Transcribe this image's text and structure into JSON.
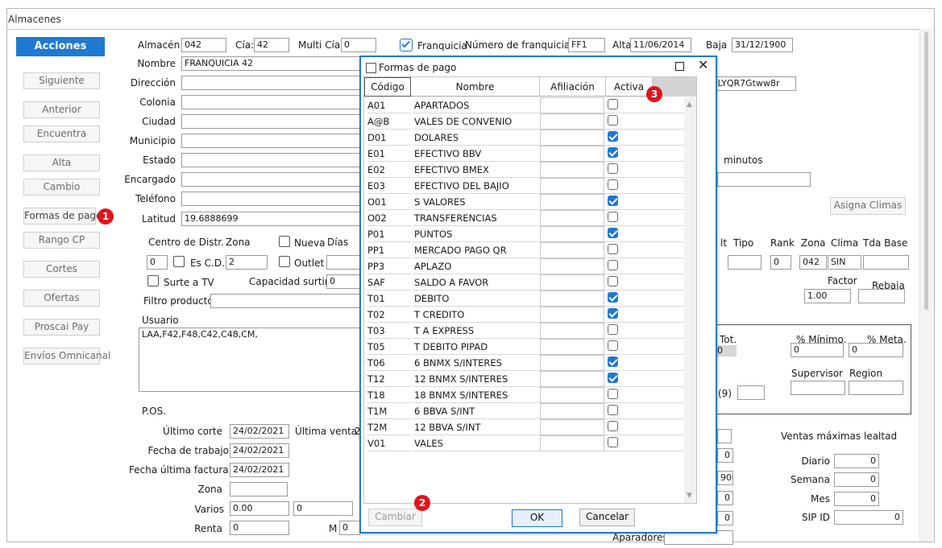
{
  "window": {
    "title": "Almacenes"
  },
  "sidebar": {
    "acciones": "Acciones",
    "buttons": [
      "Siguiente",
      "Anterior",
      "Encuentra",
      "Alta",
      "Cambio",
      "Formas de pago",
      "Rango CP",
      "Cortes",
      "Ofertas",
      "Proscai Pay",
      "Envíos Omnicanal"
    ]
  },
  "badges": {
    "b1": "1",
    "b2": "2",
    "b3": "3"
  },
  "form": {
    "almacen_label": "Almacén",
    "almacen": "042",
    "cia_label": "Cía:",
    "cia": "42",
    "multicia_label": "Multi Cía:",
    "multicia": "0",
    "franquicia_label": "Franquicia",
    "num_franquicia_label": "Número de franquicia:",
    "num_franquicia": "FF1",
    "alta_label": "Alta",
    "alta": "11/06/2014",
    "baja_label": "Baja",
    "baja": "31/12/1900",
    "nombre_label": "Nombre",
    "nombre": "FRANQUICIA 42",
    "direccion_label": "Dirección",
    "direccion_right": "MSLYQR7Gtww8r",
    "colonia_label": "Colonia",
    "ciudad_label": "Ciudad",
    "municipio_label": "Municipio",
    "estado_label": "Estado",
    "encargado_label": "Encargado",
    "telefono_label": "Teléfono",
    "latitud_label": "Latitud",
    "latitud": "19.6888699",
    "minutos_label": "minutos",
    "asigna_climas": "Asigna Climas",
    "centro_label": "Centro de Distr.",
    "zona_label": "Zona",
    "nueva_label": "Nueva",
    "dias_label": "Días",
    "centro": "0",
    "esdc_label": "Es C.D.",
    "zona": "2",
    "outlet_label": "Outlet",
    "surte_label": "Surte a TV",
    "capacidad_label": "Capacidad surtir",
    "capacidad": "0",
    "filtro_label": "Filtro productos",
    "usuario_label": "Usuario",
    "usuario": "LAA,F42,F48,C42,C48,CM,",
    "ult_label": "lt",
    "tipo_label": "Tipo",
    "rank_label": "Rank",
    "zona2_label": "Zona",
    "clima_label": "Clima",
    "tdabase_label": "Tda Base",
    "rank": "0",
    "zona2": "042",
    "clima": "SIN",
    "factor_label": "Factor",
    "factor": "1.00",
    "rebaja_label": "Rebaja",
    "tot_label": "Tot.",
    "tot_val": "0",
    "minimo_label": "% Mínimo.",
    "minimo": "0",
    "meta_label": "% Meta.",
    "meta": "0",
    "supervisor_label": "Supervisor",
    "region_label": "Region",
    "nine_label": "(9)",
    "pos_label": "P.OS.",
    "ultimo_corte_label": "Último corte",
    "ultimo_corte": "24/02/2021",
    "ultima_venta_label": "Última venta",
    "ultima_venta": "2",
    "fecha_trabajo_label": "Fecha de trabajo",
    "fecha_trabajo": "24/02/2021",
    "fecha_factura_label": "Fecha última factura",
    "fecha_factura": "24/02/2021",
    "zona_pos_label": "Zona",
    "varios_label": "Varios",
    "varios": "0.00",
    "varios2": "0",
    "renta_label": "Renta",
    "renta": "0",
    "m_label": "M",
    "m": "0",
    "ventas_max_label": "Ventas máximas lealtad",
    "diario_label": "Diario",
    "diario": "0",
    "semana_label": "Semana",
    "semana": "0",
    "mes_label": "Mes",
    "mes": "0",
    "sipid_label": "SIP ID",
    "sipid": "0",
    "mid1": "0",
    "mid2": "900",
    "mid3": "0",
    "mid4": "0",
    "aparadores_label": "Aparadores"
  },
  "modal": {
    "title": "Formas de pago",
    "columns": [
      "Código",
      "Nombre",
      "Afiliación",
      "Activa"
    ],
    "rows": [
      {
        "code": "A01",
        "name": "APARTADOS",
        "active": false
      },
      {
        "code": "A@B",
        "name": "VALES DE CONVENIO",
        "active": false
      },
      {
        "code": "D01",
        "name": "DOLARES",
        "active": true
      },
      {
        "code": "E01",
        "name": "EFECTIVO BBV",
        "active": true
      },
      {
        "code": "E02",
        "name": "EFECTIVO BMEX",
        "active": false
      },
      {
        "code": "E03",
        "name": "EFECTIVO DEL BAJIO",
        "active": false
      },
      {
        "code": "O01",
        "name": "S VALORES",
        "active": true
      },
      {
        "code": "O02",
        "name": "TRANSFERENCIAS",
        "active": false
      },
      {
        "code": "P01",
        "name": "PUNTOS",
        "active": true
      },
      {
        "code": "PP1",
        "name": "MERCADO PAGO QR",
        "active": false
      },
      {
        "code": "PP3",
        "name": "APLAZO",
        "active": false
      },
      {
        "code": "SAF",
        "name": "SALDO A FAVOR",
        "active": false
      },
      {
        "code": "T01",
        "name": "DEBITO",
        "active": true
      },
      {
        "code": "T02",
        "name": "T CREDITO",
        "active": true
      },
      {
        "code": "T03",
        "name": "T A EXPRESS",
        "active": false
      },
      {
        "code": "T05",
        "name": "T DEBITO PIPAD",
        "active": false
      },
      {
        "code": "T06",
        "name": "6 BNMX S/INTERES",
        "active": true
      },
      {
        "code": "T12",
        "name": "12 BNMX S/INTERES",
        "active": true
      },
      {
        "code": "T18",
        "name": "18 BNMX S/INTERES",
        "active": false
      },
      {
        "code": "T1M",
        "name": "6 BBVA  S/INT",
        "active": false
      },
      {
        "code": "T2M",
        "name": "12 BBVA S/INT",
        "active": false
      },
      {
        "code": "V01",
        "name": "VALES",
        "active": false
      }
    ],
    "cambiar": "Cambiar",
    "ok": "OK",
    "cancelar": "Cancelar"
  },
  "colors": {
    "accent": "#1e77d4",
    "badge": "#e0141d",
    "acciones_bg": "#1f7ad1"
  }
}
